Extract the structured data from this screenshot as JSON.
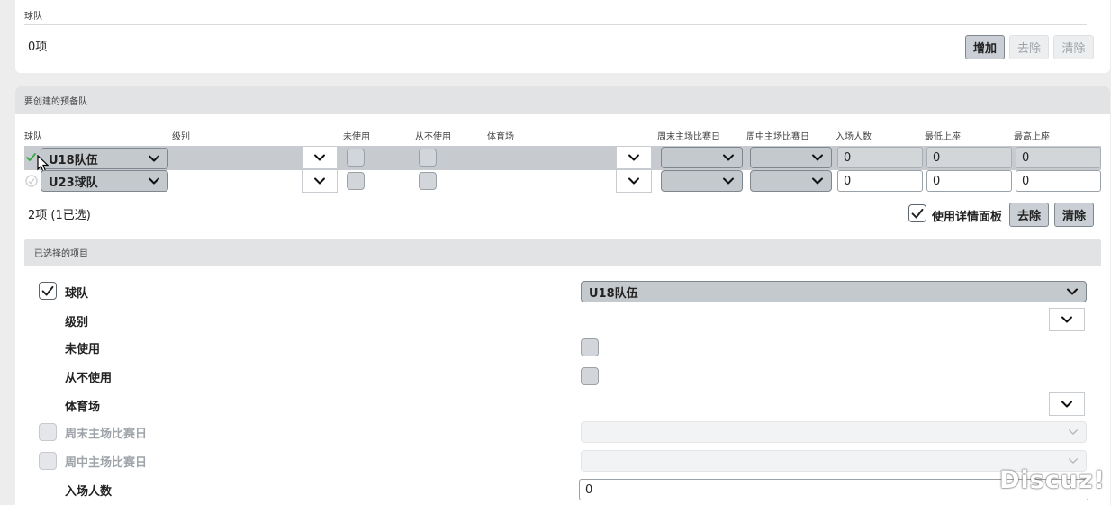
{
  "top_section": {
    "label": "球队",
    "count": "0项",
    "add_button": "增加",
    "remove_button": "去除",
    "clear_button": "清除"
  },
  "reserve_section": {
    "title": "要创建的预备队",
    "columns": [
      "球队",
      "级别",
      "未使用",
      "从不使用",
      "体育场",
      "周末主场比赛日",
      "周中主场比赛日",
      "入场人数",
      "最低上座",
      "最高上座"
    ],
    "rows": [
      {
        "team": "U18队伍",
        "attendance": "0",
        "min_attendance": "0",
        "max_attendance": "0",
        "selected": true
      },
      {
        "team": "U23球队",
        "attendance": "0",
        "min_attendance": "0",
        "max_attendance": "0",
        "selected": false
      }
    ],
    "count": "2项 (1已选)",
    "detail_panel_label": "使用详情面板",
    "remove_button": "去除",
    "clear_button": "清除"
  },
  "selected_items": {
    "title": "已选择的项目",
    "fields": {
      "team_label": "球队",
      "team_value": "U18队伍",
      "level_label": "级别",
      "unused_label": "未使用",
      "never_use_label": "从不使用",
      "stadium_label": "体育场",
      "weekend_label": "周末主场比赛日",
      "midweek_label": "周中主场比赛日",
      "attendance_label": "入场人数",
      "attendance_value": "0"
    }
  },
  "watermark": "Discuz!",
  "colors": {
    "check_green": "#3aa845",
    "panel_bg": "#ffffff",
    "page_bg": "#ededed"
  }
}
